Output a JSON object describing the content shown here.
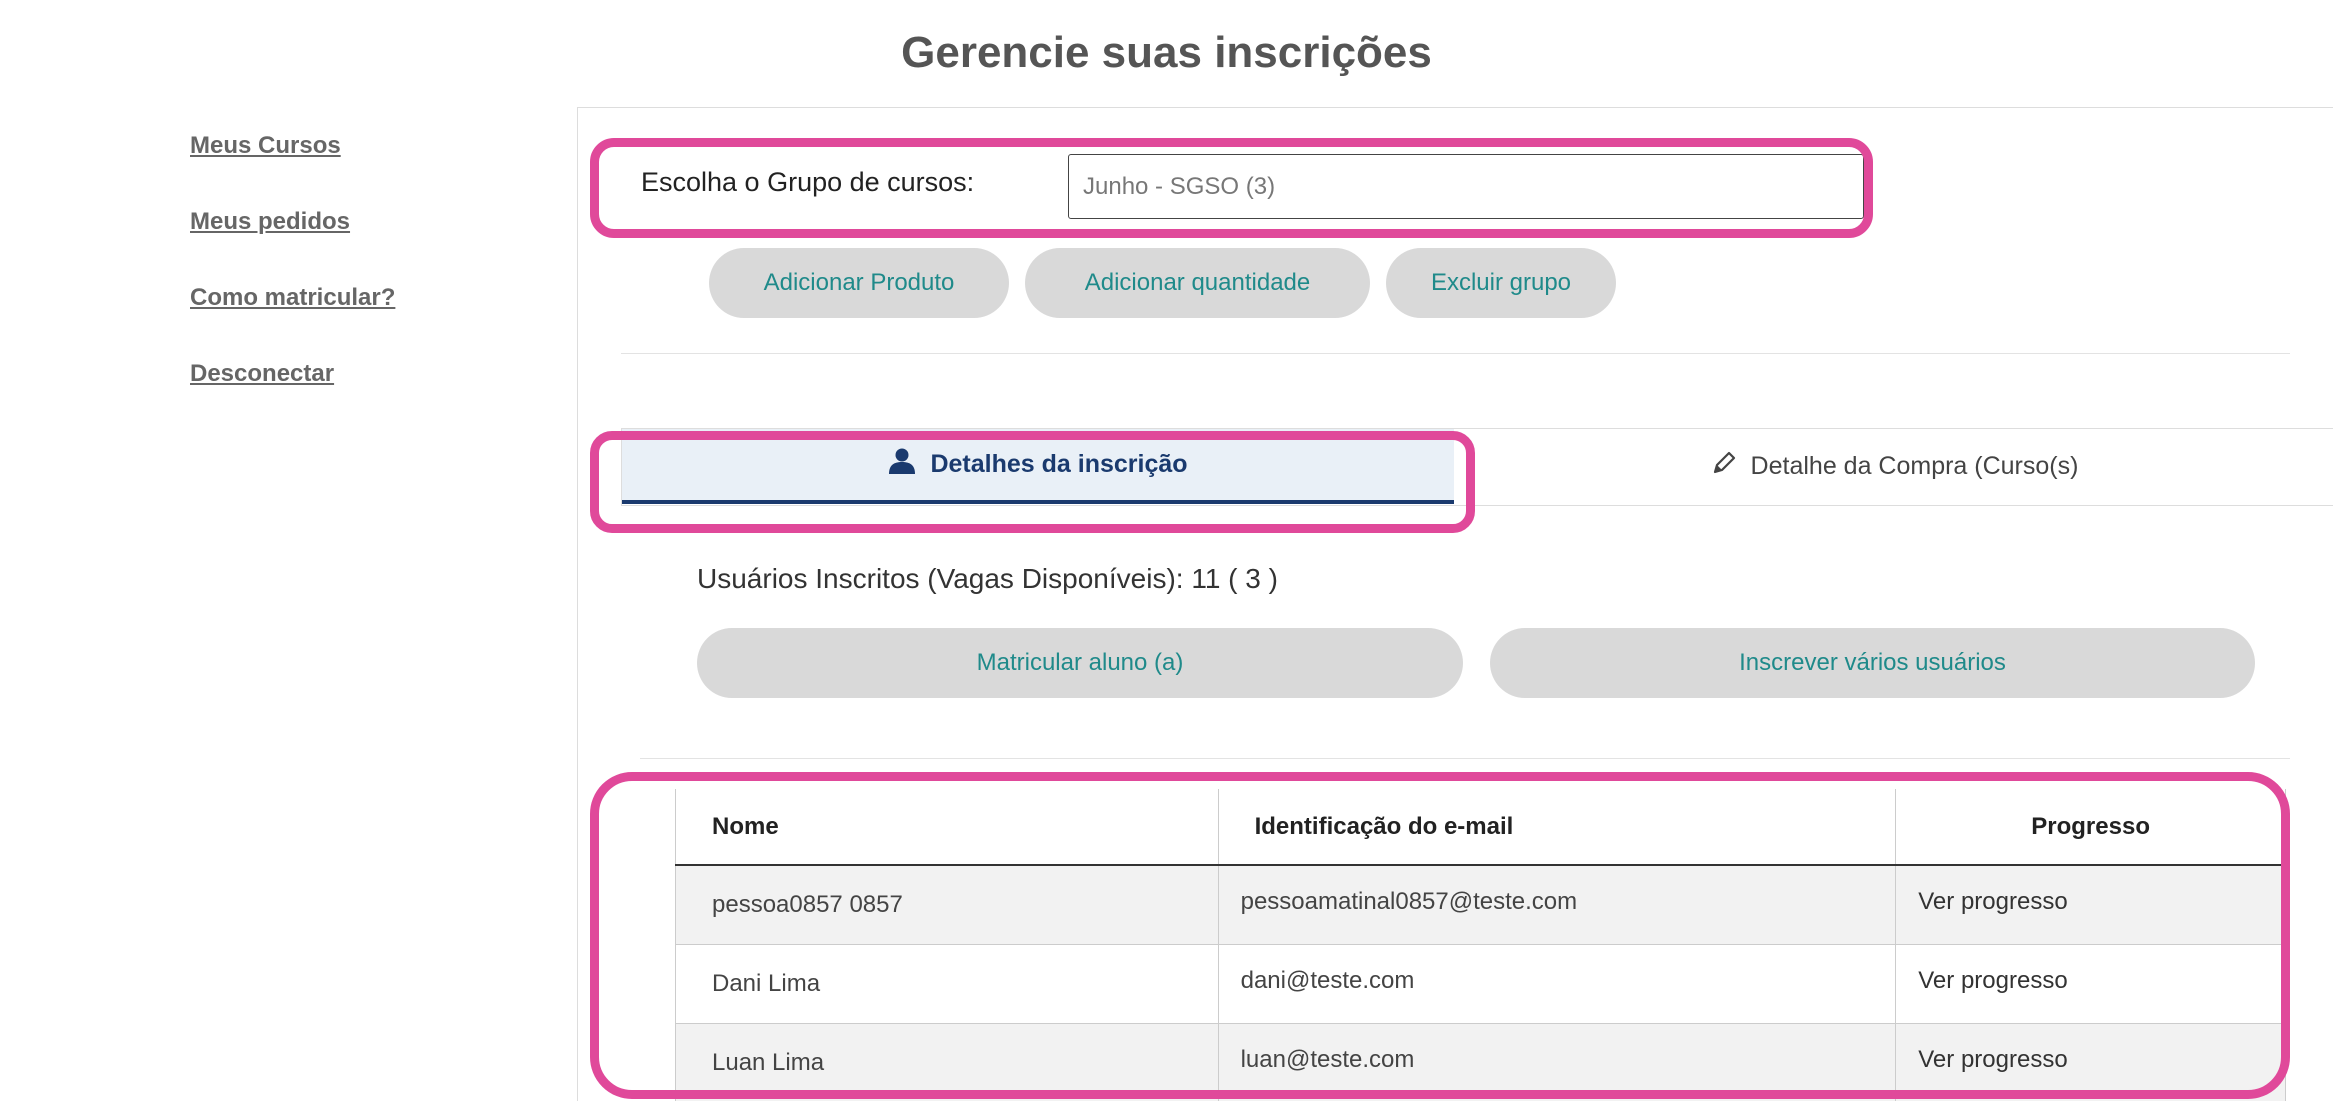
{
  "page": {
    "title": "Gerencie suas inscrições"
  },
  "sidebar": {
    "items": [
      {
        "label": "Meus Cursos"
      },
      {
        "label": "Meus pedidos"
      },
      {
        "label": "Como matricular?"
      },
      {
        "label": "Desconectar"
      }
    ]
  },
  "group": {
    "label": "Escolha o Grupo de cursos:",
    "selected": "Junho - SGSO (3)"
  },
  "group_actions": {
    "add_product": "Adicionar Produto",
    "add_quantity": "Adicionar quantidade",
    "delete_group": "Excluir grupo"
  },
  "tabs": [
    {
      "label": "Detalhes da inscrição",
      "icon": "user-icon",
      "active": true
    },
    {
      "label": "Detalhe da Compra (Curso(s)",
      "icon": "pencil-icon",
      "active": false
    }
  ],
  "enrollment": {
    "label": "Usuários Inscritos (Vagas Disponíveis):",
    "count": "11 ( 3 )"
  },
  "enroll_actions": {
    "enroll_student": "Matricular aluno (a)",
    "enroll_many": "Inscrever vários usuários"
  },
  "table": {
    "headers": {
      "name": "Nome",
      "email": "Identificação do e-mail",
      "progress": "Progresso"
    },
    "rows": [
      {
        "name": "pessoa0857 0857",
        "email": "pessoamatinal0857@teste.com",
        "progress": "Ver progresso"
      },
      {
        "name": "Dani Lima",
        "email": "dani@teste.com",
        "progress": "Ver progresso"
      },
      {
        "name": "Luan Lima",
        "email": "luan@teste.com",
        "progress": "Ver progresso"
      }
    ]
  },
  "colors": {
    "highlight": "#e0499a",
    "accent": "#1a3a6e",
    "button_text": "#1f8a8a"
  }
}
